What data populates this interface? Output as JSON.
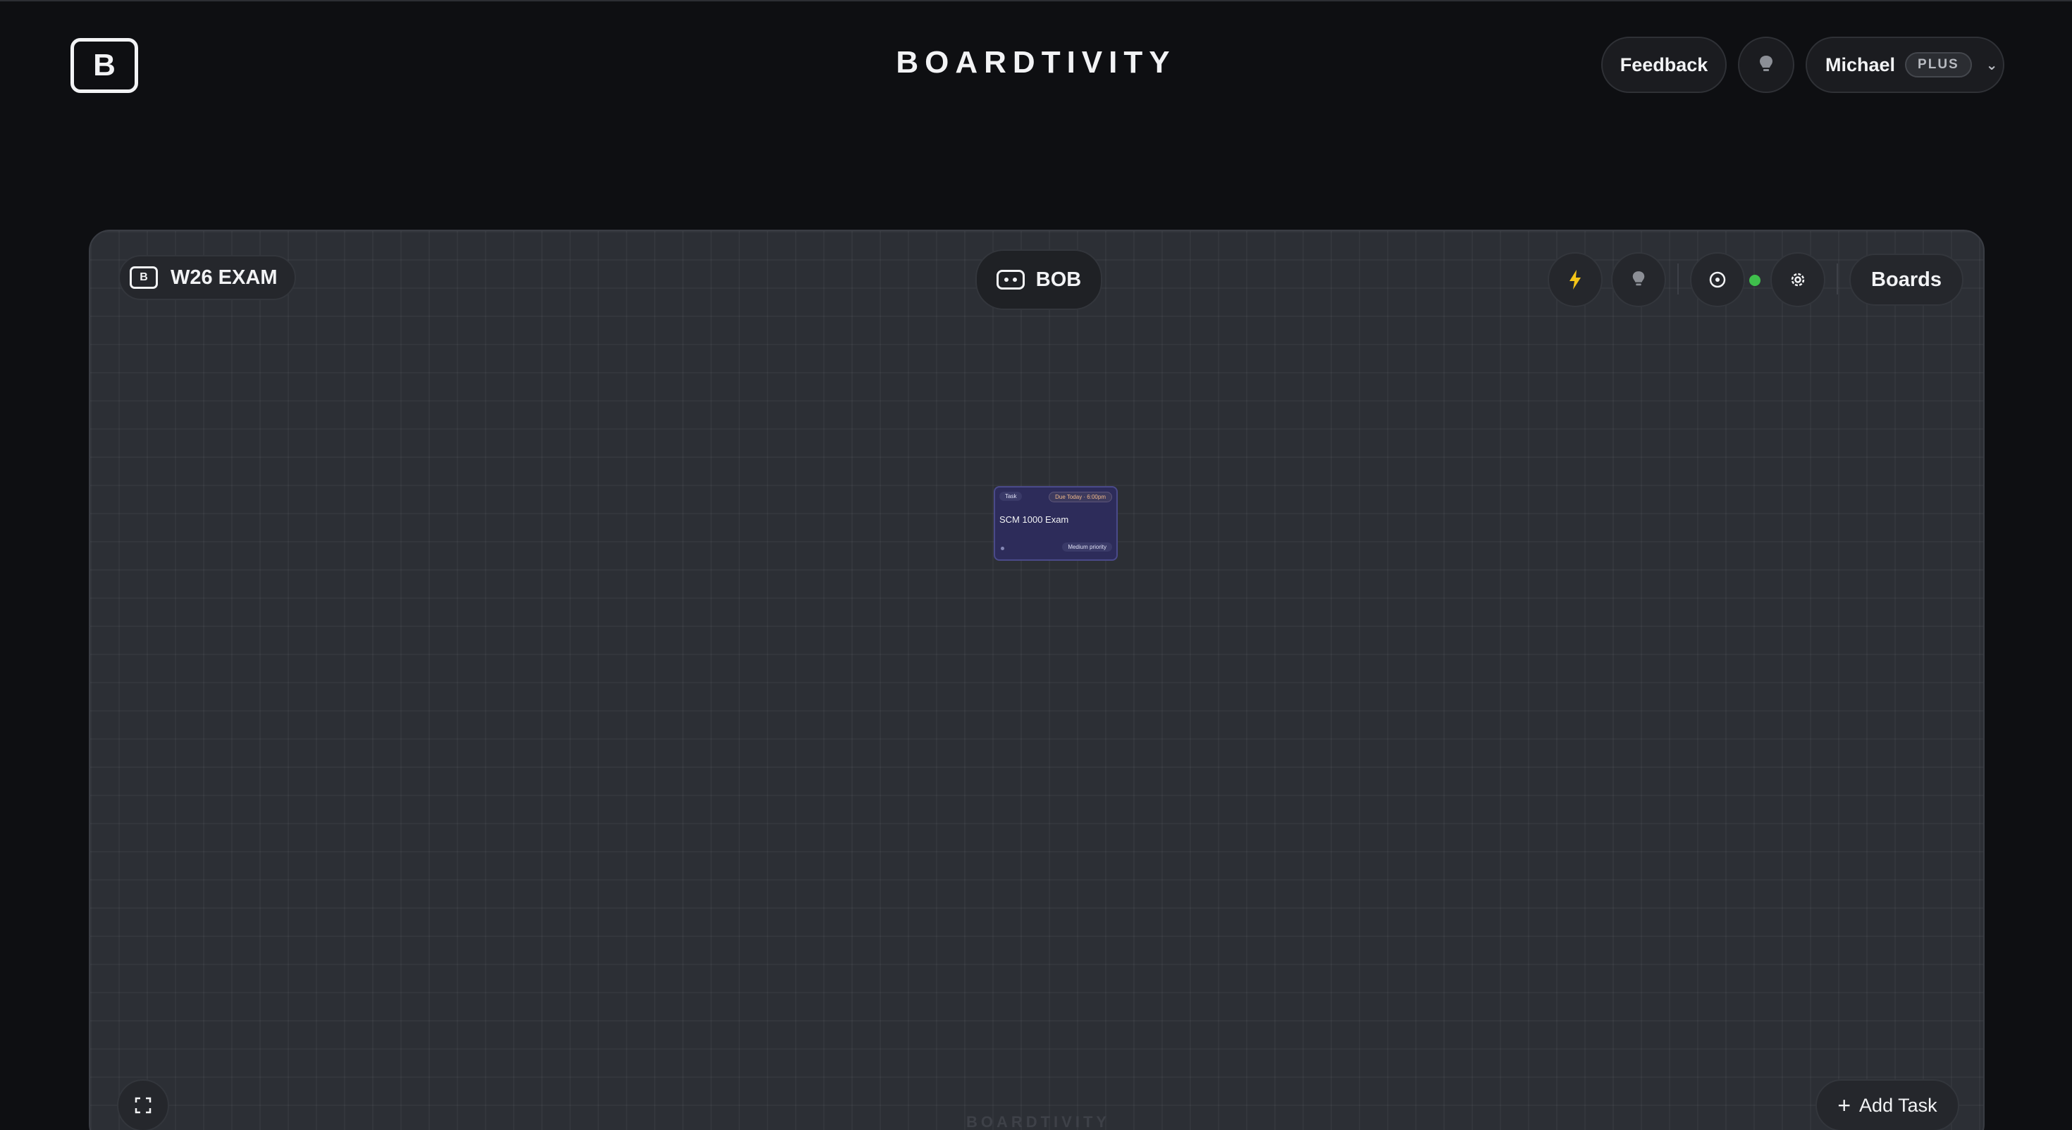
{
  "header": {
    "logo_letter": "B",
    "app_title": "BOARDTIVITY",
    "feedback_label": "Feedback",
    "user": {
      "name": "Michael",
      "plan": "PLUS"
    }
  },
  "board": {
    "name": "W26 EXAM",
    "logo_letter": "B",
    "assistant_label": "BOB",
    "boards_label": "Boards",
    "add_task_label": "Add Task",
    "watermark": "BOARDTIVITY",
    "status_color": "#3fbf4c",
    "tasks": [
      {
        "type": "Task",
        "due": "Due Today · 6:00pm",
        "title": "SCM 1000 Exam",
        "priority": "Medium priority"
      }
    ]
  },
  "colors": {
    "background": "#0e0f12",
    "board_background": "#2c2f35",
    "task_card": "#2d2c5a",
    "bolt": "#f5c518"
  },
  "icons": [
    "lightbulb-icon",
    "chevron-down-icon",
    "robot-icon",
    "lightning-bolt-icon",
    "target-icon",
    "gear-icon",
    "fullscreen-icon",
    "plus-icon"
  ]
}
